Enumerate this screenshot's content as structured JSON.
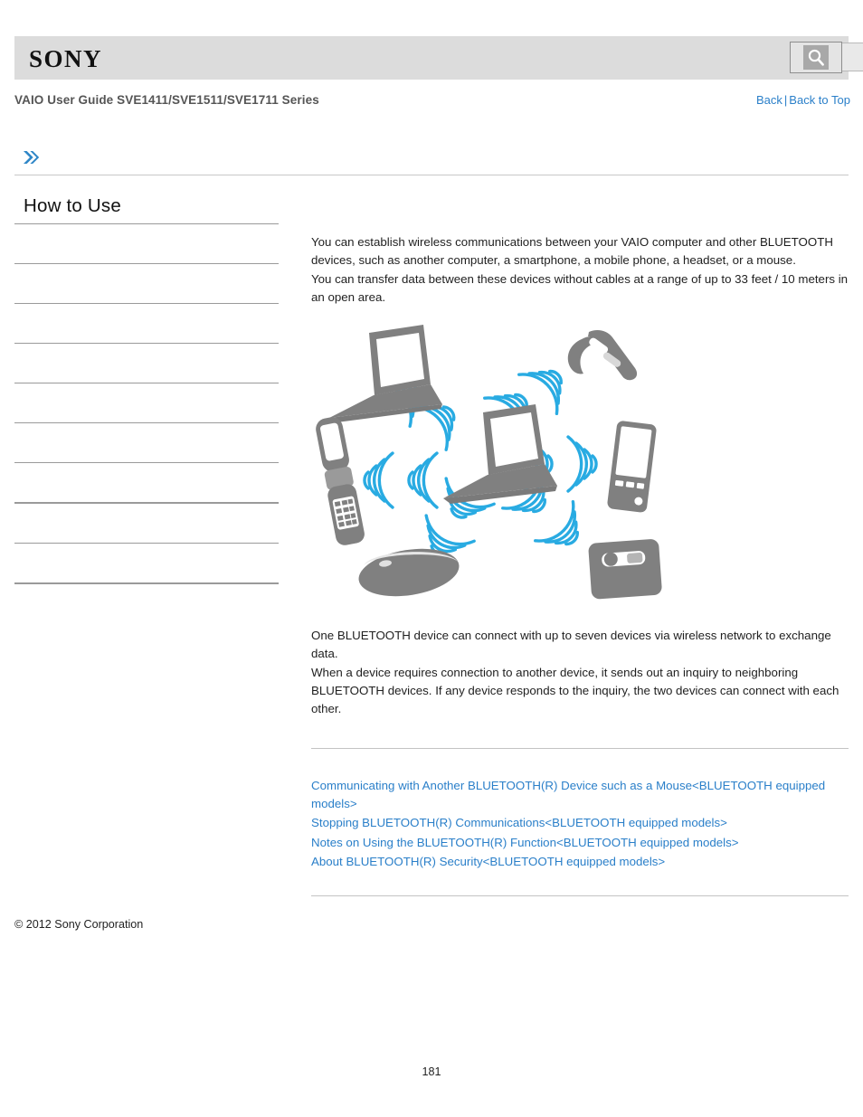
{
  "header": {
    "logo_text": "SONY",
    "logo_icon": "sony-wordmark",
    "guide_title": "VAIO User Guide SVE1411/SVE1511/SVE1711 Series",
    "search": {
      "value": "",
      "placeholder": "",
      "button_icon": "search-icon"
    },
    "nav": {
      "back_label": "Back",
      "separator": "|",
      "back_to_top_label": "Back to Top"
    }
  },
  "breadcrumb": {
    "icon": "double-chevron-right-icon",
    "text": ""
  },
  "sidebar": {
    "title": "How to Use",
    "items": [
      {
        "label": ""
      },
      {
        "label": ""
      },
      {
        "label": ""
      },
      {
        "label": ""
      },
      {
        "label": ""
      },
      {
        "label": ""
      },
      {
        "label": ""
      },
      {
        "label": ""
      },
      {
        "label": ""
      },
      {
        "label": ""
      }
    ]
  },
  "main": {
    "paragraph_one": "You can establish wireless communications between your VAIO computer and other BLUETOOTH devices, such as another computer, a smartphone, a mobile phone, a headset, or a mouse.\nYou can transfer data between these devices without cables at a range of up to 33 feet / 10 meters in an open area.",
    "paragraph_two": "One BLUETOOTH device can connect with up to seven devices via wireless network to exchange data.\nWhen a device requires connection to another device, it sends out an inquiry to neighboring BLUETOOTH devices. If any device responds to the inquiry, the two devices can connect with each other.",
    "illustration": {
      "name": "bluetooth-network-diagram",
      "device_color": "#808080",
      "wave_color": "#29ABE2",
      "screen_color": "#ffffff",
      "devices": [
        "laptop-top-left",
        "bluetooth-headset-top-right",
        "flip-phone-left",
        "central-laptop",
        "smartphone-right",
        "mouse-bottom",
        "camera-bottom-right"
      ],
      "connection_count": 6
    },
    "related_links": [
      "Communicating with Another BLUETOOTH(R) Device such as a Mouse<BLUETOOTH equipped models>",
      "Stopping BLUETOOTH(R) Communications<BLUETOOTH equipped models>",
      "Notes on Using the BLUETOOTH(R) Function<BLUETOOTH equipped models>",
      "About BLUETOOTH(R) Security<BLUETOOTH equipped models>"
    ]
  },
  "footer": {
    "copyright": "© 2012 Sony Corporation",
    "page_number": "181"
  },
  "colors": {
    "link_blue": "#2a7fc9",
    "header_gray": "#dcdcdc",
    "device_gray": "#808080",
    "wave_blue": "#29ABE2",
    "rule_gray": "#9a9a9a"
  }
}
